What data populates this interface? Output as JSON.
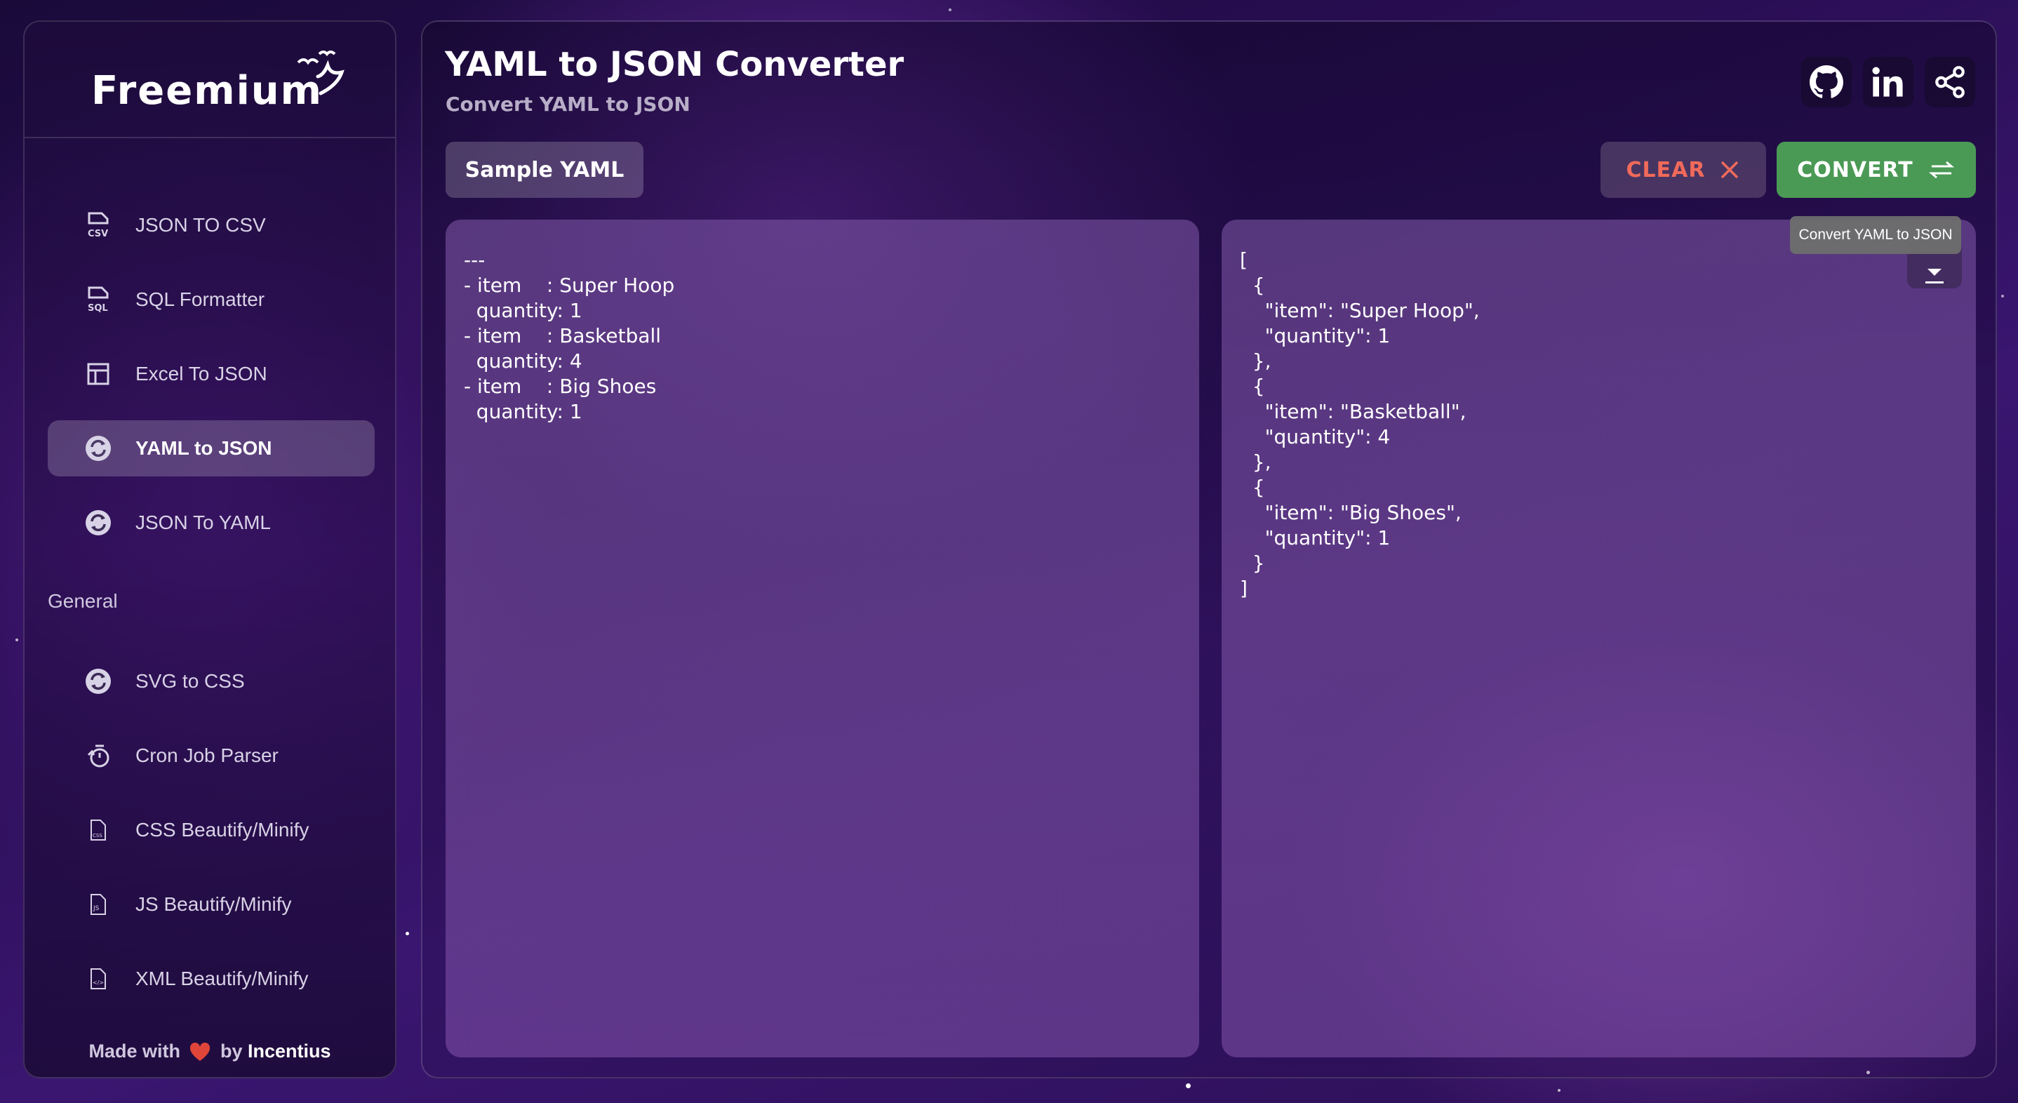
{
  "sidebar": {
    "logo": "Freemium",
    "items": [
      {
        "label": "JSON TO CSV",
        "icon": "csv-file-icon"
      },
      {
        "label": "SQL Formatter",
        "icon": "sql-file-icon"
      },
      {
        "label": "Excel To JSON",
        "icon": "table-icon"
      },
      {
        "label": "YAML to JSON",
        "icon": "convert-icon",
        "active": true
      },
      {
        "label": "JSON To YAML",
        "icon": "convert-icon"
      }
    ],
    "section_general": "General",
    "general_items": [
      {
        "label": "SVG to CSS",
        "icon": "convert-icon"
      },
      {
        "label": "Cron Job Parser",
        "icon": "timer-icon"
      },
      {
        "label": "CSS Beautify/Minify",
        "icon": "css-file-icon"
      },
      {
        "label": "JS Beautify/Minify",
        "icon": "js-file-icon"
      },
      {
        "label": "XML Beautify/Minify",
        "icon": "xml-file-icon"
      }
    ],
    "footer": {
      "made_with": "Made with",
      "by": "by",
      "brand": "Incentius"
    }
  },
  "header": {
    "title": "YAML to JSON Converter",
    "subtitle": "Convert YAML to JSON",
    "social": [
      "github-icon",
      "linkedin-icon",
      "share-icon"
    ]
  },
  "toolbar": {
    "sample_label": "Sample YAML",
    "clear_label": "CLEAR",
    "convert_label": "CONVERT",
    "convert_tooltip": "Convert YAML to JSON"
  },
  "input": {
    "text": "---\n- item    : Super Hoop\n  quantity: 1\n- item    : Basketball\n  quantity: 4\n- item    : Big Shoes\n  quantity: 1"
  },
  "output": {
    "text": "[\n  {\n    \"item\": \"Super Hoop\",\n    \"quantity\": 1\n  },\n  {\n    \"item\": \"Basketball\",\n    \"quantity\": 4\n  },\n  {\n    \"item\": \"Big Shoes\",\n    \"quantity\": 1\n  }\n]"
  },
  "colors": {
    "convert_green": "#4a9a55",
    "clear_red": "#f06a5a",
    "heart": "#e0453a"
  }
}
